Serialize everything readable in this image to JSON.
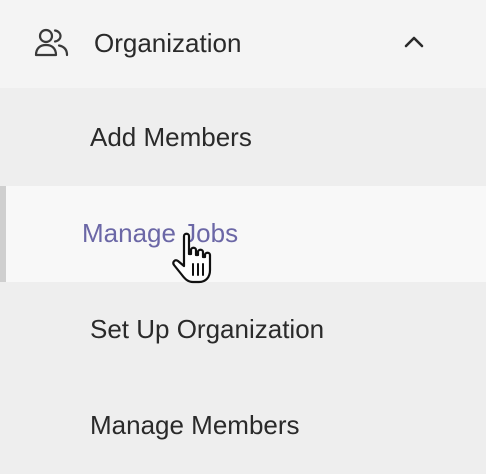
{
  "menu": {
    "section": {
      "title": "Organization",
      "icon": "people-icon",
      "toggle_icon": "chevron-up-icon",
      "expanded": true
    },
    "items": [
      {
        "label": "Add Members",
        "active": false
      },
      {
        "label": "Manage Jobs",
        "active": true
      },
      {
        "label": "Set Up Organization",
        "active": false
      },
      {
        "label": "Manage Members",
        "active": false
      }
    ]
  },
  "colors": {
    "active_text": "#6b67a6",
    "text": "#2a2a2a",
    "background": "#eeeeee",
    "active_background": "#f8f8f8"
  },
  "cursor": {
    "icon": "hand-pointer-icon"
  }
}
